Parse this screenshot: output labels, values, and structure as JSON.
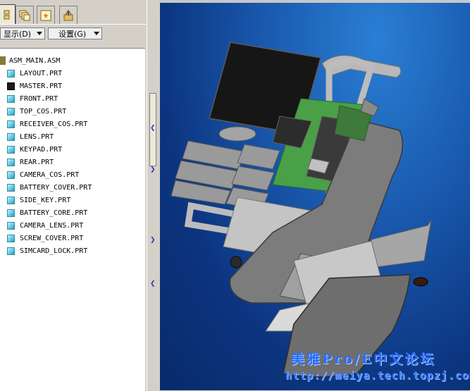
{
  "tabs": [
    "model-tree",
    "layers",
    "notes",
    "tools"
  ],
  "toolbar": {
    "show_label": "显示(D)",
    "settings_label": "设置(G)"
  },
  "tree": {
    "root": "ASM_MAIN.ASM",
    "items": [
      "LAYOUT.PRT",
      "MASTER.PRT",
      "FRONT.PRT",
      "TOP_COS.PRT",
      "RECEIVER_COS.PRT",
      "LENS.PRT",
      "KEYPAD.PRT",
      "REAR.PRT",
      "CAMERA_COS.PRT",
      "BATTERY_COVER.PRT",
      "SIDE_KEY.PRT",
      "BATTERY_CORE.PRT",
      "CAMERA_LENS.PRT",
      "SCREW_COVER.PRT",
      "SIMCARD_LOCK.PRT"
    ]
  },
  "viewport": {
    "watermark_title": "美雅Pro/E中文论坛",
    "watermark_url": "http://meiya.tech.topzj.com"
  },
  "colors": {
    "background_top": "#2a7fd4",
    "background_bottom": "#082a6a",
    "watermark": "#3a7cff"
  }
}
